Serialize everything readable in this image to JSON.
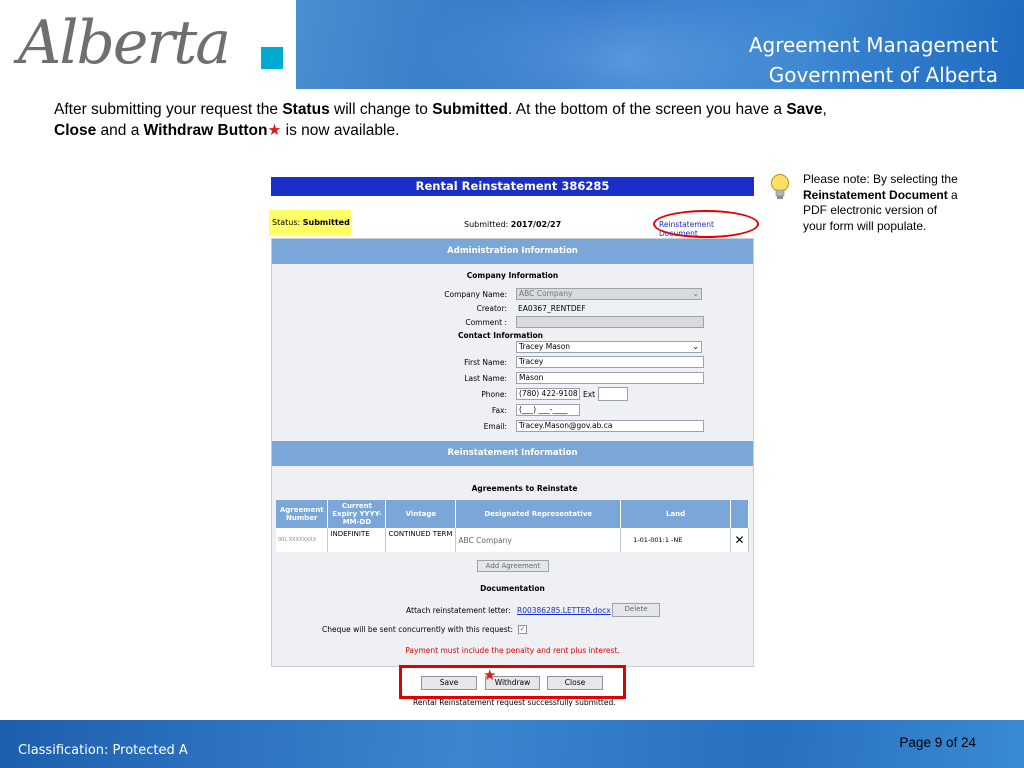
{
  "header": {
    "logo_text": "Alberta",
    "title_line1": "Agreement Management",
    "title_line2": "Government of Alberta"
  },
  "intro": {
    "part1": "After submitting your request the ",
    "status_word": "Status",
    "part2": " will change to ",
    "submitted_word": "Submitted",
    "part3": ".  At the bottom of the screen you have a ",
    "save_word": "Save",
    "part4": ",",
    "close_word": "Close",
    "part5": " and a ",
    "withdraw_word": "Withdraw Button",
    "star": "★",
    "part6": " is now available."
  },
  "note": {
    "part1": "Please note: By selecting the ",
    "bold": "Reinstatement Document",
    "part2": " a PDF electronic version of your form will populate."
  },
  "form": {
    "title": "Rental Reinstatement 386285",
    "status_label": "Status:",
    "status_value": "Submitted",
    "submitted_label": "Submitted:",
    "submitted_date": "2017/02/27",
    "reinstatement_doc_link": "Reinstatement Document",
    "admin_section": "Administration Information",
    "company_info_head": "Company Information",
    "company_name_label": "Company Name:",
    "company_name_value": "ABC Company",
    "creator_label": "Creator:",
    "creator_value": "EA0367_RENTDEF",
    "comment_label": "Comment :",
    "contact_info_head": "Contact Information",
    "contact_select_value": "Tracey Mason",
    "first_name_label": "First Name:",
    "first_name_value": "Tracey",
    "last_name_label": "Last Name:",
    "last_name_value": "Mason",
    "phone_label": "Phone:",
    "phone_value": "(780) 422-9108",
    "ext_label": "Ext",
    "fax_label": "Fax:",
    "fax_value": "(___) ___-____",
    "email_label": "Email:",
    "email_value": "Tracey.Mason@gov.ab.ca",
    "reinst_section": "Reinstatement Information",
    "agreements_head": "Agreements to Reinstate",
    "table": {
      "headers": [
        "Agreement Number",
        "Current Expiry YYYY-MM-DD",
        "Vintage",
        "Designated Representative",
        "Land"
      ],
      "row": {
        "agreement": "00L XXXXXXXX",
        "expiry": "INDEFINITE",
        "vintage": "CONTINUED TERM",
        "rep": "ABC Company",
        "land": "1-01-001:1 -NE",
        "remove_icon": "✕"
      }
    },
    "add_agreement": "Add Agreement",
    "documentation_head": "Documentation",
    "attach_label": "Attach reinstatement letter:",
    "attach_file": "R00386285.LETTER.docx",
    "delete_btn": "Delete",
    "cheque_label": "Cheque will be sent concurrently with this request:",
    "cheque_check": "✓",
    "warning": "Payment must include the penalty and rent plus interest."
  },
  "buttons": {
    "save": "Save",
    "withdraw": "Withdraw",
    "close": "Close",
    "star": "★",
    "success": "Rental Reinstatement request successfully submitted."
  },
  "footer": {
    "classification": "Classification: Protected A",
    "page": "Page 9 of 24"
  }
}
